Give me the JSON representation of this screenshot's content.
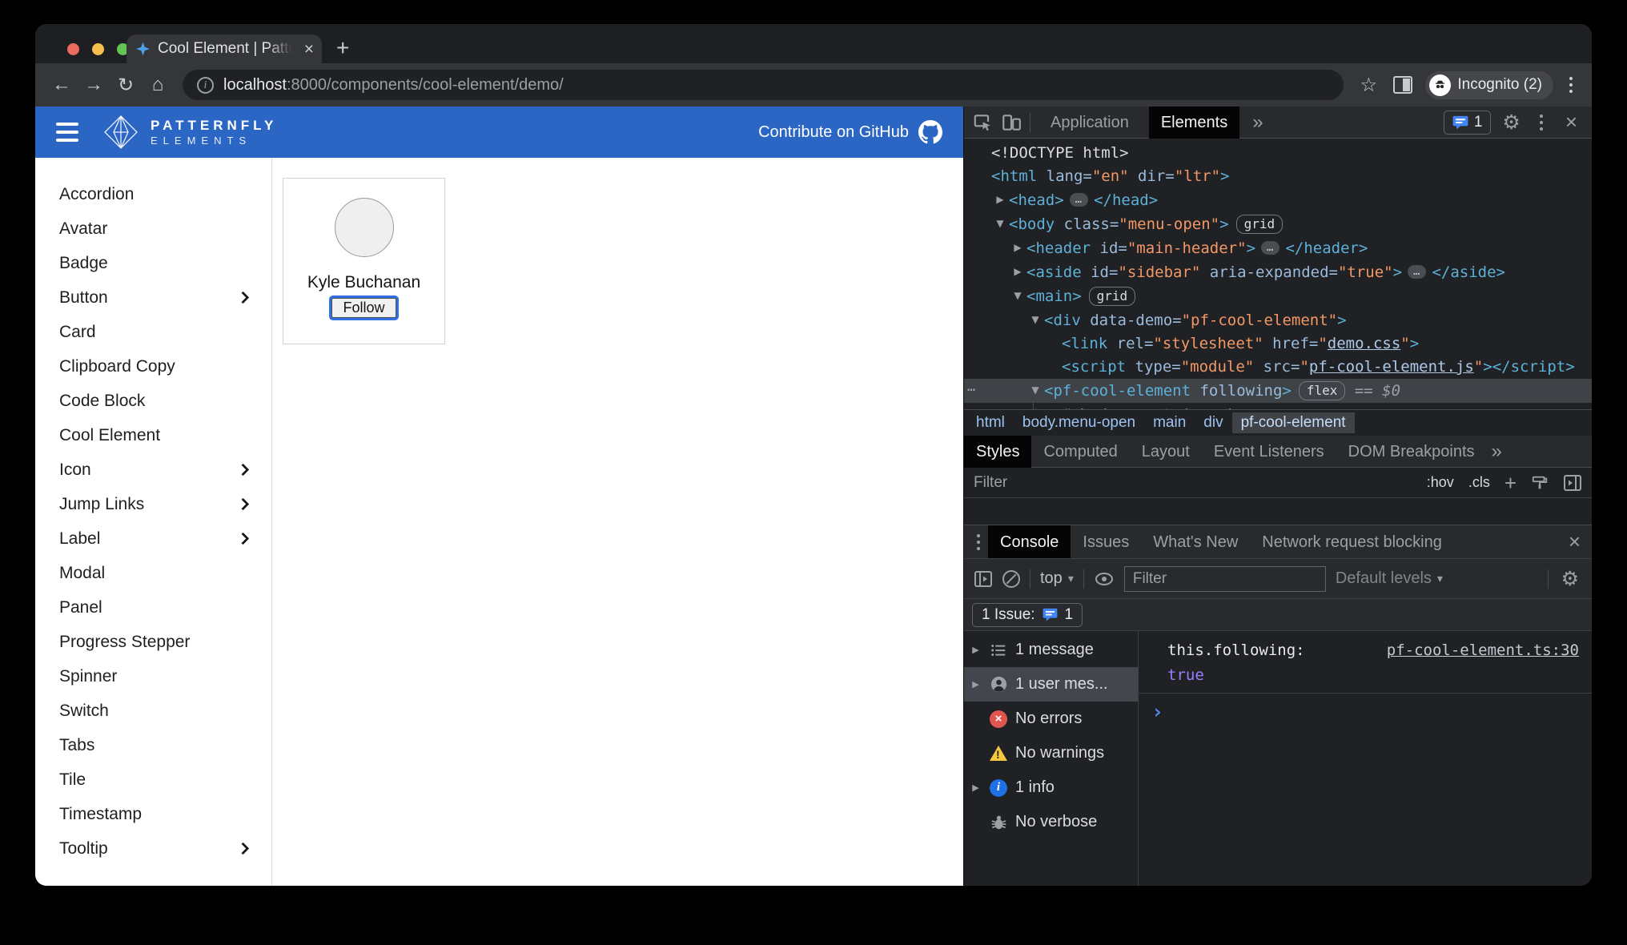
{
  "browser": {
    "tab_title": "Cool Element | PatternFly Elem",
    "url_host": "localhost",
    "url_rest": ":8000/components/cool-element/demo/",
    "incognito_label": "Incognito (2)"
  },
  "icons": {
    "back": "←",
    "forward": "→",
    "reload": "↻",
    "home": "⌂",
    "star": "☆",
    "new_tab": "+",
    "close": "×",
    "more": "»",
    "caret": "▾",
    "overflow": "⋯"
  },
  "site_header": {
    "brand_line1": "PATTERNFLY",
    "brand_line2": "ELEMENTS",
    "contribute_label": "Contribute on GitHub"
  },
  "sidebar": {
    "items": [
      {
        "label": "Accordion"
      },
      {
        "label": "Avatar"
      },
      {
        "label": "Badge"
      },
      {
        "label": "Button",
        "chevron": true
      },
      {
        "label": "Card"
      },
      {
        "label": "Clipboard Copy"
      },
      {
        "label": "Code Block"
      },
      {
        "label": "Cool Element"
      },
      {
        "label": "Icon",
        "chevron": true
      },
      {
        "label": "Jump Links",
        "chevron": true
      },
      {
        "label": "Label",
        "chevron": true
      },
      {
        "label": "Modal"
      },
      {
        "label": "Panel"
      },
      {
        "label": "Progress Stepper"
      },
      {
        "label": "Spinner"
      },
      {
        "label": "Switch"
      },
      {
        "label": "Tabs"
      },
      {
        "label": "Tile"
      },
      {
        "label": "Timestamp"
      },
      {
        "label": "Tooltip",
        "chevron": true
      }
    ]
  },
  "demo_card": {
    "name": "Kyle Buchanan",
    "follow_label": "Follow"
  },
  "devtools": {
    "top_tabs": {
      "application": "Application",
      "elements": "Elements",
      "issues_count": "1"
    },
    "tree": {
      "lines": [
        {
          "ind": 0,
          "arrow": "",
          "seg": [
            {
              "c": "plain",
              "t": "<!DOCTYPE html>"
            }
          ]
        },
        {
          "ind": 0,
          "arrow": "",
          "seg": [
            {
              "c": "tag",
              "t": "<html"
            },
            {
              "c": "attr",
              "t": " lang="
            },
            {
              "c": "val",
              "t": "\"en\""
            },
            {
              "c": "attr",
              "t": " dir="
            },
            {
              "c": "val",
              "t": "\"ltr\""
            },
            {
              "c": "tag",
              "t": ">"
            }
          ]
        },
        {
          "ind": 1,
          "arrow": "▶",
          "seg": [
            {
              "c": "tag",
              "t": "<head>"
            },
            {
              "c": "ell",
              "t": "…"
            },
            {
              "c": "tag",
              "t": "</head>"
            }
          ]
        },
        {
          "ind": 1,
          "arrow": "▼",
          "seg": [
            {
              "c": "tag",
              "t": "<body"
            },
            {
              "c": "attr",
              "t": " class="
            },
            {
              "c": "val",
              "t": "\"menu-open\""
            },
            {
              "c": "tag",
              "t": ">"
            },
            {
              "c": "badge",
              "t": "grid"
            }
          ]
        },
        {
          "ind": 2,
          "arrow": "▶",
          "seg": [
            {
              "c": "tag",
              "t": "<header"
            },
            {
              "c": "attr",
              "t": " id="
            },
            {
              "c": "val",
              "t": "\"main-header\""
            },
            {
              "c": "tag",
              "t": ">"
            },
            {
              "c": "ell",
              "t": "…"
            },
            {
              "c": "tag",
              "t": "</header>"
            }
          ]
        },
        {
          "ind": 2,
          "arrow": "▶",
          "seg": [
            {
              "c": "tag",
              "t": "<aside"
            },
            {
              "c": "attr",
              "t": " id="
            },
            {
              "c": "val",
              "t": "\"sidebar\""
            },
            {
              "c": "attr",
              "t": " aria-expanded="
            },
            {
              "c": "val",
              "t": "\"true\""
            },
            {
              "c": "tag",
              "t": ">"
            },
            {
              "c": "ell",
              "t": "…"
            },
            {
              "c": "tag",
              "t": "</aside>"
            }
          ]
        },
        {
          "ind": 2,
          "arrow": "▼",
          "seg": [
            {
              "c": "tag",
              "t": "<main>"
            },
            {
              "c": "badge",
              "t": "grid"
            }
          ]
        },
        {
          "ind": 3,
          "arrow": "▼",
          "seg": [
            {
              "c": "tag",
              "t": "<div"
            },
            {
              "c": "attr",
              "t": " data-demo="
            },
            {
              "c": "val",
              "t": "\"pf-cool-element\""
            },
            {
              "c": "tag",
              "t": ">"
            }
          ]
        },
        {
          "ind": 4,
          "arrow": "",
          "seg": [
            {
              "c": "tag",
              "t": "<link"
            },
            {
              "c": "attr",
              "t": " rel="
            },
            {
              "c": "val",
              "t": "\"stylesheet\""
            },
            {
              "c": "attr",
              "t": " href="
            },
            {
              "c": "val",
              "t": "\""
            },
            {
              "c": "link",
              "t": "demo.css"
            },
            {
              "c": "val",
              "t": "\""
            },
            {
              "c": "tag",
              "t": ">"
            }
          ]
        },
        {
          "ind": 4,
          "arrow": "",
          "seg": [
            {
              "c": "tag",
              "t": "<script"
            },
            {
              "c": "attr",
              "t": " type="
            },
            {
              "c": "val",
              "t": "\"module\""
            },
            {
              "c": "attr",
              "t": " src="
            },
            {
              "c": "val",
              "t": "\""
            },
            {
              "c": "link",
              "t": "pf-cool-element.js"
            },
            {
              "c": "val",
              "t": "\""
            },
            {
              "c": "tag",
              "t": ">"
            },
            {
              "c": "tag",
              "t": "</script>"
            }
          ]
        },
        {
          "ind": 3,
          "arrow": "▼",
          "sel": true,
          "seg": [
            {
              "c": "tag",
              "t": "<pf-cool-element"
            },
            {
              "c": "attr",
              "t": " following"
            },
            {
              "c": "tag",
              "t": ">"
            },
            {
              "c": "badge",
              "t": "flex"
            },
            {
              "c": "eq",
              "t": " == "
            },
            {
              "c": "dollar",
              "t": "$0"
            }
          ]
        },
        {
          "ind": 4,
          "arrow": "▶",
          "seg": [
            {
              "c": "shadow",
              "t": "#shadow-root"
            },
            {
              "c": "shadowp",
              "t": " (open)"
            }
          ]
        }
      ]
    },
    "breadcrumbs": {
      "items": [
        {
          "label": "html"
        },
        {
          "label": "body.menu-open"
        },
        {
          "label": "main"
        },
        {
          "label": "div"
        },
        {
          "label": "pf-cool-element",
          "state": "active"
        }
      ]
    },
    "styles_tabs": {
      "styles": "Styles",
      "computed": "Computed",
      "layout": "Layout",
      "event_listeners": "Event Listeners",
      "dom_breakpoints": "DOM Breakpoints"
    },
    "styles_filter": {
      "placeholder": "Filter",
      "hov": ":hov",
      "cls": ".cls"
    },
    "console": {
      "tabs": {
        "console": "Console",
        "issues": "Issues",
        "whats_new": "What's New",
        "network_blocking": "Network request blocking"
      },
      "toolbar": {
        "context": "top",
        "filter_placeholder": "Filter",
        "levels": "Default levels"
      },
      "issue_bar": {
        "label": "1 Issue:",
        "count": "1"
      },
      "sidebar_rows": [
        {
          "arrow": "▶",
          "icon": "list",
          "label": "1 message"
        },
        {
          "arrow": "▶",
          "icon": "user",
          "label": "1 user mes...",
          "state": "selected"
        },
        {
          "arrow": "",
          "icon": "error",
          "label": "No errors"
        },
        {
          "arrow": "",
          "icon": "warning",
          "label": "No warnings"
        },
        {
          "arrow": "▶",
          "icon": "info",
          "label": "1 info"
        },
        {
          "arrow": "",
          "icon": "bug",
          "label": "No verbose"
        }
      ],
      "message": {
        "label": "this.following:",
        "value": "true",
        "source": "pf-cool-element.ts:30",
        "prompt": "›"
      }
    }
  },
  "colors": {
    "header_blue": "#2b66c4",
    "focus_blue": "#2f6fe0",
    "issue_blue": "#4285f4",
    "error_red": "#e0564e",
    "warning_yellow": "#f5c63f",
    "bool_violet": "#9980ff"
  }
}
